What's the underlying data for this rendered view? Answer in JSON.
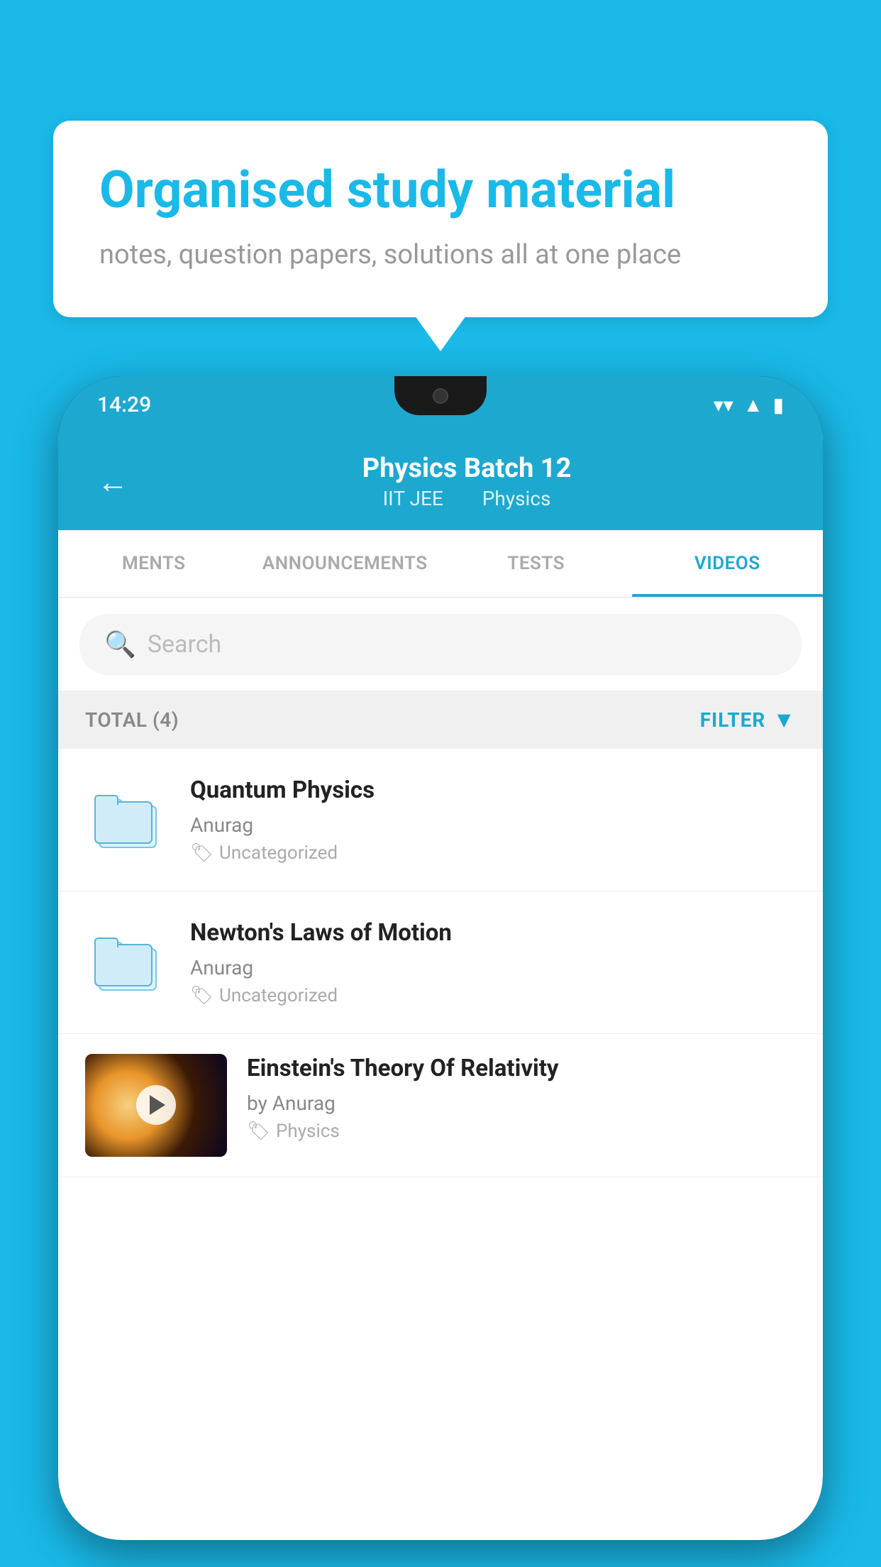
{
  "background": {
    "color": "#1ab9e8"
  },
  "speech_bubble": {
    "title": "Organised study material",
    "subtitle": "notes, question papers, solutions all at one place"
  },
  "phone": {
    "status_bar": {
      "time": "14:29"
    },
    "header": {
      "back_label": "←",
      "title": "Physics Batch 12",
      "subtitle_part1": "IIT JEE",
      "subtitle_part2": "Physics"
    },
    "tabs": [
      {
        "label": "MENTS",
        "active": false
      },
      {
        "label": "ANNOUNCEMENTS",
        "active": false
      },
      {
        "label": "TESTS",
        "active": false
      },
      {
        "label": "VIDEOS",
        "active": true
      }
    ],
    "search": {
      "placeholder": "Search"
    },
    "filter_bar": {
      "total_label": "TOTAL (4)",
      "filter_label": "FILTER"
    },
    "videos": [
      {
        "id": 1,
        "title": "Quantum Physics",
        "author": "Anurag",
        "tag": "Uncategorized",
        "type": "folder"
      },
      {
        "id": 2,
        "title": "Newton's Laws of Motion",
        "author": "Anurag",
        "tag": "Uncategorized",
        "type": "folder"
      },
      {
        "id": 3,
        "title": "Einstein's Theory Of Relativity",
        "author": "by Anurag",
        "tag": "Physics",
        "type": "thumbnail"
      }
    ]
  }
}
